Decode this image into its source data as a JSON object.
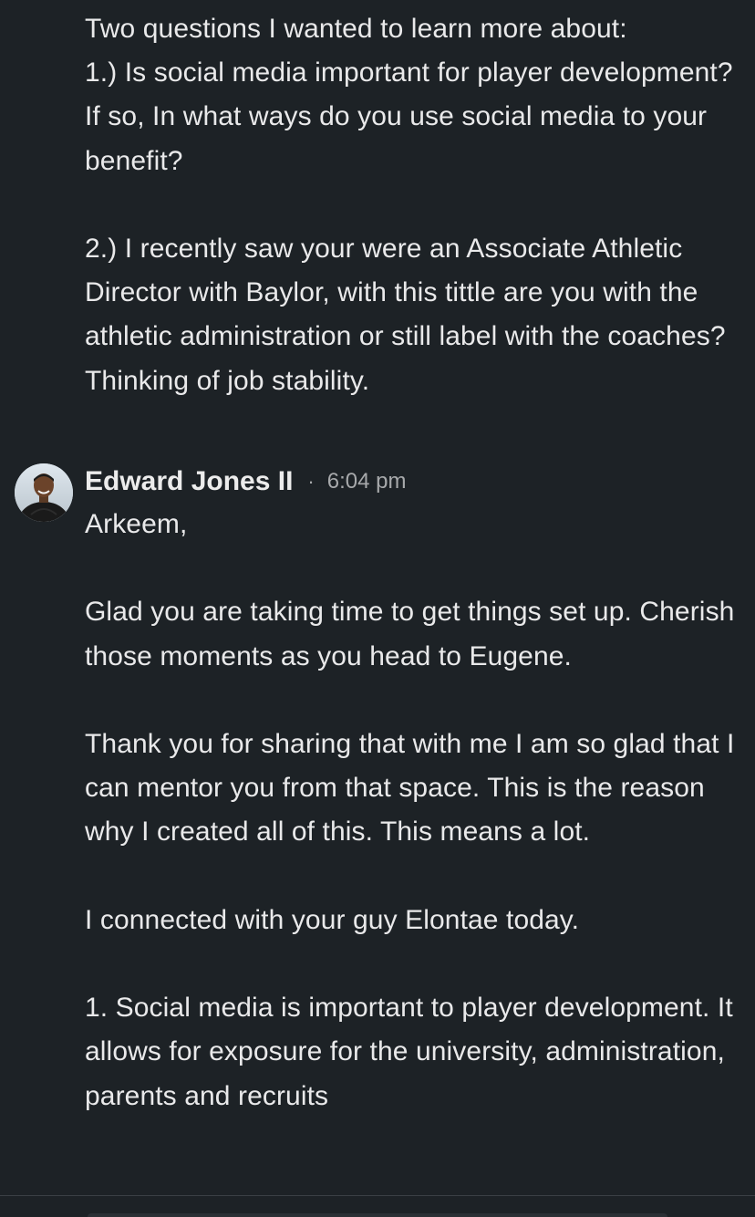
{
  "previous_message": {
    "paragraphs": [
      "Two questions I wanted to learn more about:\n1.) Is social media important for player development? If so, In what ways do you use social media to your benefit?",
      "2.) I recently saw your were an Associate Athletic Director with Baylor, with this tittle are you with the athletic administration or still label with the coaches? Thinking of job stability."
    ]
  },
  "reply": {
    "sender_name": "Edward Jones II",
    "separator": "·",
    "time": "6:04 pm",
    "avatar_icon": "profile-photo",
    "paragraphs": [
      "Arkeem,",
      "Glad you are taking time to get things set up. Cherish those moments as you head to Eugene.",
      "Thank you for sharing that with me I am so glad that I can mentor you from that space. This is the reason why I created all of this. This means a lot.",
      "I connected with your guy Elontae today.",
      "1. Social media is important to player development. It allows for exposure for the university, administration, parents and recruits"
    ]
  },
  "colors": {
    "background": "#1d2226",
    "text": "#e9e9ea",
    "meta_text": "#a7a9ab"
  }
}
